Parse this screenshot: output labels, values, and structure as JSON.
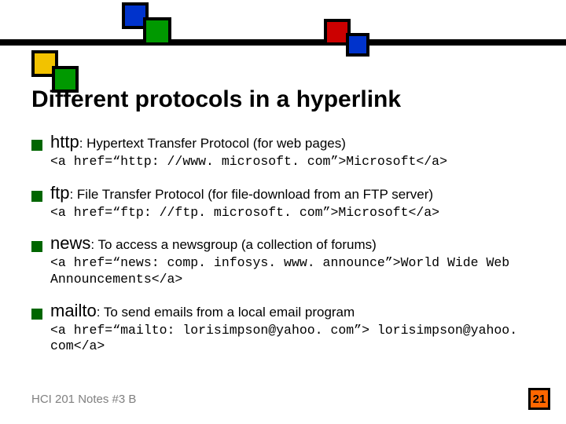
{
  "title": "Different protocols in a hyperlink",
  "items": [
    {
      "term": "http",
      "desc": ": Hypertext Transfer Protocol (for web pages)",
      "code": "<a href=“http: //www. microsoft. com”>Microsoft</a>"
    },
    {
      "term": "ftp",
      "desc": ": File Transfer Protocol (for file-download from an FTP server)",
      "code": "<a href=“ftp: //ftp. microsoft. com”>Microsoft</a>"
    },
    {
      "term": "news",
      "desc": ": To access a newsgroup (a collection of forums)",
      "code": "<a href=“news: comp. infosys. www. announce”>World Wide Web Announcements</a>"
    },
    {
      "term": "mailto",
      "desc": ": To send emails from a local email program",
      "code": "<a href=“mailto: lorisimpson@yahoo. com”> lorisimpson@yahoo. com</a>"
    }
  ],
  "footer": "HCI 201 Notes #3 B",
  "page": "21"
}
